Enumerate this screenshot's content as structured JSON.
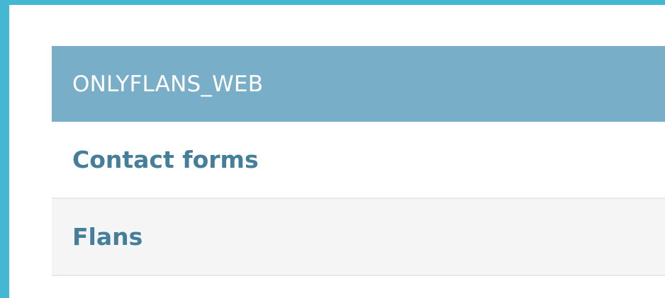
{
  "app_module": {
    "caption": "ONLYFLANS_WEB",
    "items": [
      {
        "label": "Contact forms"
      },
      {
        "label": "Flans"
      }
    ]
  },
  "colors": {
    "frame": "#44b8d2",
    "caption_bg": "#79aec8",
    "link": "#447e9b",
    "row_alt_bg": "#f5f5f5"
  }
}
